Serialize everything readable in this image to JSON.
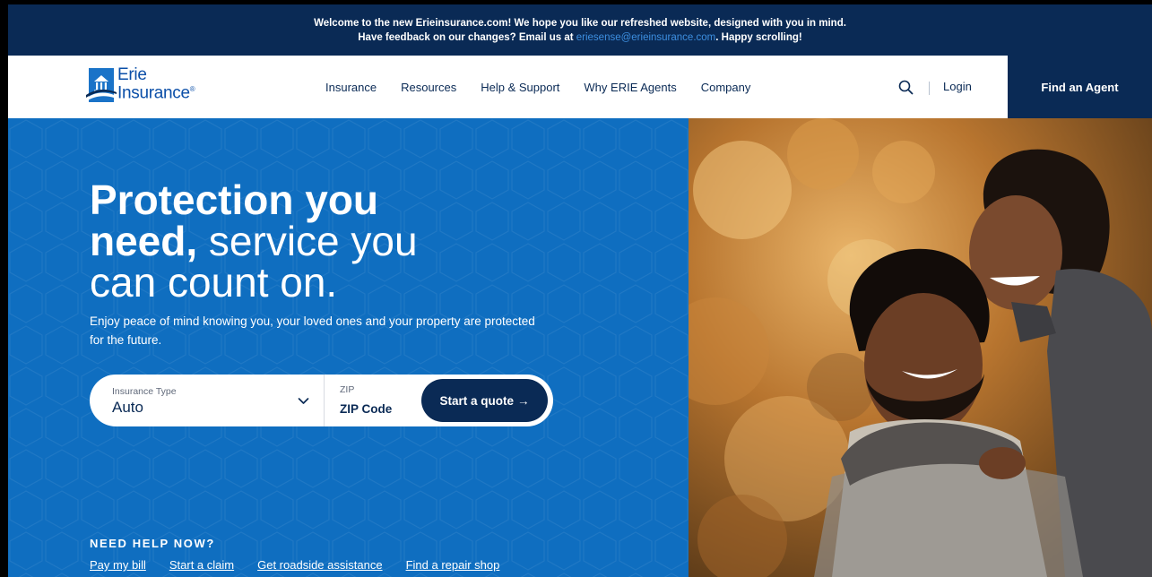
{
  "banner": {
    "text_before": "Welcome to the new Erieinsurance.com! We hope you like our refreshed website, designed with you in mind. Have feedback on our changes? Email us at ",
    "email": "eriesense@erieinsurance.com",
    "text_after": ". Happy scrolling!"
  },
  "header": {
    "logo_line1": "Erie",
    "logo_line2": "Insurance",
    "logo_reg": "®",
    "nav": [
      "Insurance",
      "Resources",
      "Help & Support",
      "Why ERIE Agents",
      "Company"
    ],
    "login": "Login",
    "find_agent": "Find an Agent"
  },
  "hero": {
    "headline_bold1": "Protection you",
    "headline_bold2": "need,",
    "headline_light1": " service you",
    "headline_light2": "can count on.",
    "subtext": "Enjoy peace of mind knowing you, your loved ones and your property are protected for the future."
  },
  "quote": {
    "type_label": "Insurance Type",
    "type_value": "Auto",
    "zip_label": "ZIP",
    "zip_placeholder": "ZIP Code",
    "start_label": "Start a quote",
    "start_arrow": "→"
  },
  "help": {
    "title": "NEED HELP NOW?",
    "links": [
      "Pay my bill",
      "Start a claim",
      "Get roadside assistance",
      "Find a repair shop"
    ]
  },
  "colors": {
    "navy": "#0a2a55",
    "hero_blue": "#0f6ec0",
    "link_blue": "#3d8fe0"
  },
  "icons": [
    "erie-logo-icon",
    "search-icon",
    "chevron-down-icon",
    "arrow-right-icon"
  ]
}
